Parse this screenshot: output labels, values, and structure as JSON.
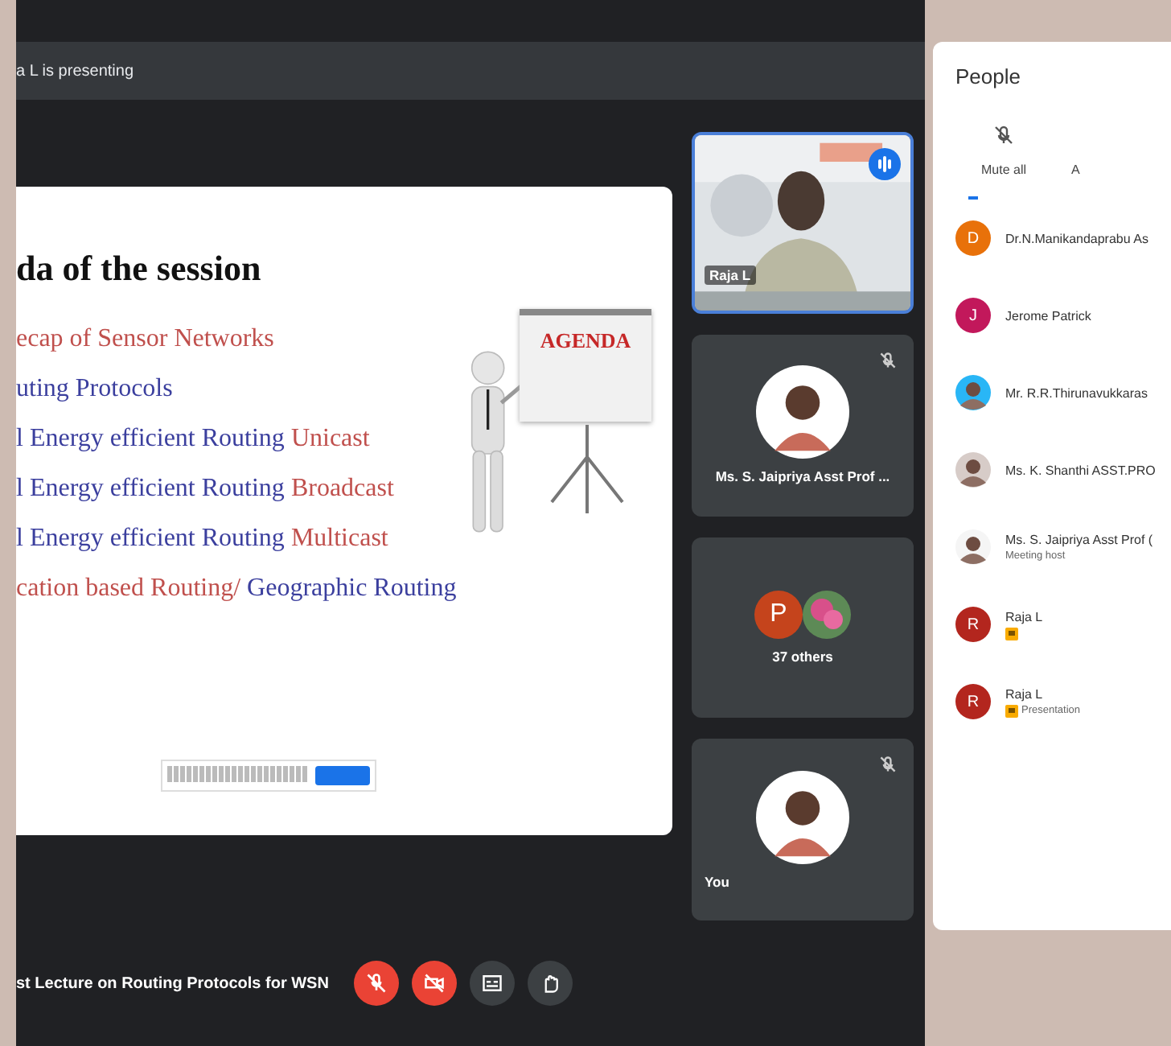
{
  "presenting_bar": {
    "text": "a L is presenting"
  },
  "slide": {
    "title": "da of  the session",
    "illustration_label": "AGENDA",
    "items": [
      {
        "segments": [
          {
            "text": "ecap of Sensor Networks",
            "color": "#c0504d"
          }
        ]
      },
      {
        "segments": [
          {
            "text": "uting Protocols",
            "color": "#3b3f9e"
          }
        ]
      },
      {
        "segments": [
          {
            "text": "l Energy efficient Routing ",
            "color": "#3b3f9e"
          },
          {
            "text": "Unicast",
            "color": "#c0504d"
          }
        ]
      },
      {
        "segments": [
          {
            "text": "l Energy efficient Routing ",
            "color": "#3b3f9e"
          },
          {
            "text": "Broadcast",
            "color": "#c0504d"
          }
        ]
      },
      {
        "segments": [
          {
            "text": "l Energy efficient Routing ",
            "color": "#3b3f9e"
          },
          {
            "text": "Multicast",
            "color": "#c0504d"
          }
        ]
      },
      {
        "segments": [
          {
            "text": "cation based Routing/ ",
            "color": "#c0504d"
          },
          {
            "text": "Geographic Routing",
            "color": "#3b3f9e"
          }
        ]
      }
    ]
  },
  "tiles": [
    {
      "kind": "video",
      "name": "Raja L"
    },
    {
      "kind": "avatar",
      "name": "Ms. S. Jaipriya Asst Prof ...",
      "muted": true
    },
    {
      "kind": "group",
      "letter": "P",
      "color": "#c5441c",
      "name": "37 others"
    },
    {
      "kind": "avatar",
      "name": "You",
      "muted": true
    }
  ],
  "bottom_bar": {
    "meeting_title": "st Lecture on Routing Protocols for WSN",
    "buttons": [
      {
        "kind": "mic",
        "on": false
      },
      {
        "kind": "camera",
        "on": false
      },
      {
        "kind": "captions",
        "on": true
      },
      {
        "kind": "hand",
        "on": true
      }
    ]
  },
  "people_panel": {
    "title": "People",
    "actions": [
      "Mute all",
      "A"
    ],
    "participants": [
      {
        "kind": "letter",
        "letter": "D",
        "color": "#e8710a",
        "name": "Dr.N.Manikandaprabu As"
      },
      {
        "kind": "letter",
        "letter": "J",
        "color": "#c2185b",
        "name": "Jerome Patrick"
      },
      {
        "color": "#29b6f6",
        "name": "Mr. R.R.Thirunavukkaras"
      },
      {
        "color": "#d7ccc8",
        "name": "Ms. K. Shanthi ASST.PRO"
      },
      {
        "color": "#f5f5f5",
        "name": "Ms. S. Jaipriya Asst Prof (",
        "subtitle": "Meeting host"
      },
      {
        "kind": "letter",
        "letter": "R",
        "color": "#b3261e",
        "name": "Raja L",
        "badge": true
      },
      {
        "kind": "letter",
        "letter": "R",
        "color": "#b3261e",
        "name": "Raja L",
        "badge": true,
        "subtitle": "Presentation"
      }
    ]
  }
}
